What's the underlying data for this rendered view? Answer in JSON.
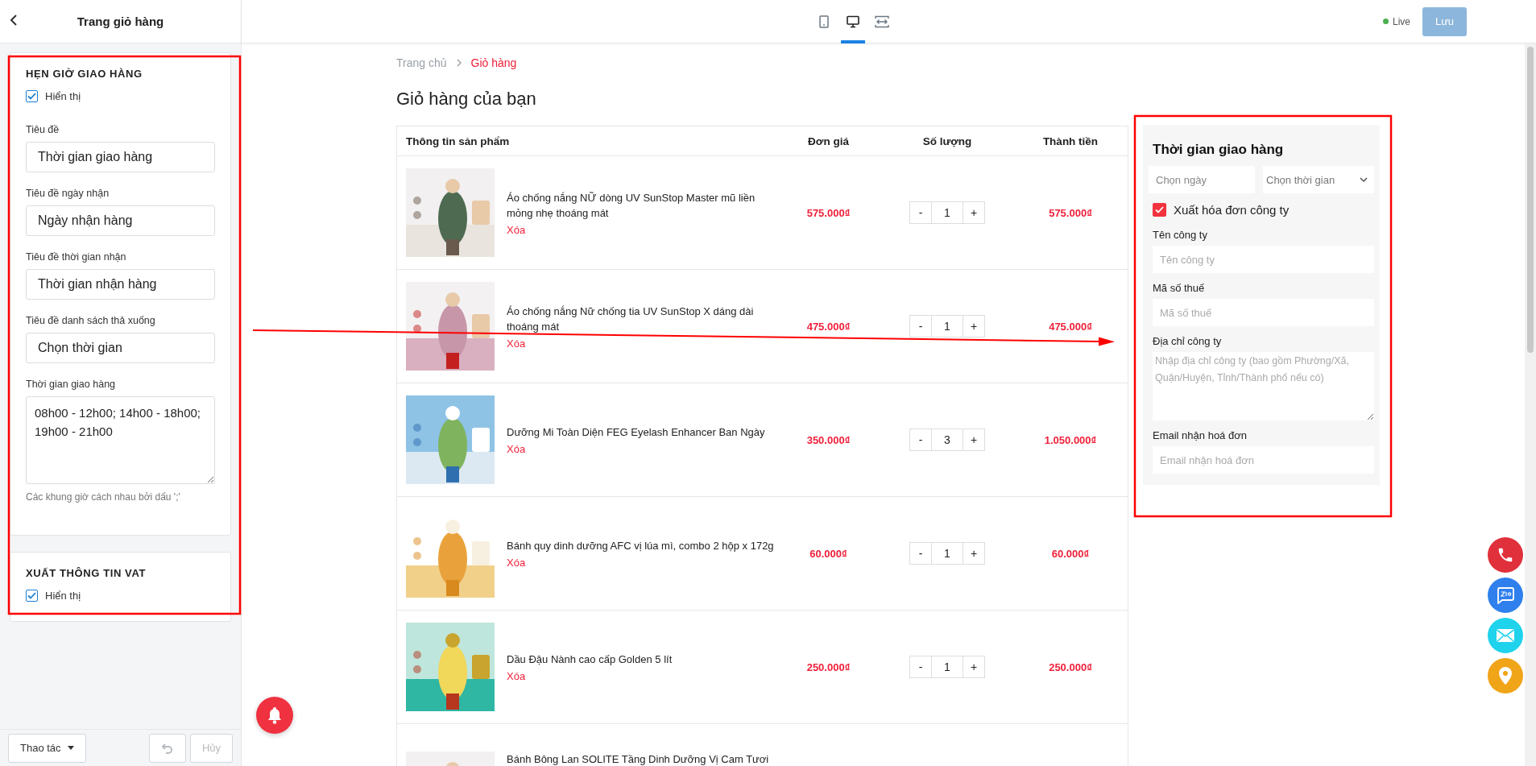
{
  "sidebar": {
    "title": "Trang giỏ hàng",
    "sections": [
      {
        "heading": "HẸN GIỜ GIAO HÀNG",
        "show": {
          "label": "Hiển thị",
          "checked": true
        },
        "fields": [
          {
            "kind": "input",
            "label": "Tiêu đề",
            "value": "Thời gian giao hàng"
          },
          {
            "kind": "input",
            "label": "Tiêu đề ngày nhận",
            "value": "Ngày nhận hàng"
          },
          {
            "kind": "input",
            "label": "Tiêu đề thời gian nhận",
            "value": "Thời gian nhận hàng"
          },
          {
            "kind": "input",
            "label": "Tiêu đề danh sách thả xuống",
            "value": "Chọn thời gian"
          },
          {
            "kind": "textarea",
            "label": "Thời gian giao hàng",
            "value": "08h00 - 12h00; 14h00 - 18h00; 19h00 - 21h00"
          }
        ],
        "hint": "Các khung giờ cách nhau bởi dấu ';'"
      },
      {
        "heading": "XUẤT THÔNG TIN VAT",
        "show": {
          "label": "Hiển thị",
          "checked": true
        }
      }
    ],
    "footer": {
      "actions_button": "Thao tác",
      "undo": {
        "disabled": true
      },
      "cancel": {
        "label": "Hủy",
        "disabled": true
      }
    }
  },
  "topbar": {
    "device_tabs": [
      {
        "kind": "tablet",
        "selected": false
      },
      {
        "kind": "desktop",
        "selected": true
      },
      {
        "kind": "fit-width",
        "selected": false
      }
    ],
    "status": "Live",
    "save": {
      "label": "Lưu",
      "disabled": true
    }
  },
  "breadcrumb": [
    {
      "label": "Trang chủ",
      "selected": false
    },
    {
      "label": "Giỏ hàng",
      "selected": true
    }
  ],
  "page_title": "Giỏ hàng của bạn",
  "table": {
    "columns": [
      "Thông tin sản phẩm",
      "Đơn giá",
      "Số lượng",
      "Thành tiền"
    ],
    "rows": [
      {
        "name": "Áo chống nắng NỮ dòng UV SunStop Master mũ liền mỏng nhẹ thoáng mát",
        "action": "Xóa",
        "price": "575.000₫",
        "quantity": "1",
        "total": "575.000₫"
      },
      {
        "name": "Áo chống nắng Nữ chống tia UV SunStop X dáng dài thoáng mát",
        "action": "Xóa",
        "price": "475.000₫",
        "quantity": "1",
        "total": "475.000₫"
      },
      {
        "name": "Dưỡng Mi Toàn Diện FEG Eyelash Enhancer Ban Ngày",
        "action": "Xóa",
        "price": "350.000₫",
        "quantity": "3",
        "total": "1.050.000₫"
      },
      {
        "name": "Bánh quy dinh dưỡng AFC vị lúa mì, combo 2 hộp x 172g",
        "action": "Xóa",
        "price": "60.000₫",
        "quantity": "1",
        "total": "60.000₫"
      },
      {
        "name": "Dầu Đậu Nành cao cấp Golden 5 lít",
        "action": "Xóa",
        "price": "250.000₫",
        "quantity": "1",
        "total": "250.000₫"
      },
      {
        "name": "Bánh Bông Lan SOLITE Tầng Dinh Dưỡng Vị Cam Tươi"
      }
    ],
    "minus": "-",
    "plus": "+"
  },
  "delivery": {
    "title": "Thời gian giao hàng",
    "date_placeholder": "Chọn ngày",
    "time_placeholder": "Chọn thời gian",
    "invoice": {
      "label": "Xuất hóa đơn công ty",
      "checked": true
    },
    "fields": [
      {
        "kind": "input",
        "label": "Tên công ty",
        "placeholder": "Tên công ty"
      },
      {
        "kind": "input",
        "label": "Mã số thuế",
        "placeholder": "Mã số thuế"
      },
      {
        "kind": "textarea",
        "label": "Địa chỉ công ty",
        "placeholder": "Nhập địa chỉ công ty (bao gồm Phường/Xã, Quận/Huyện, Tỉnh/Thành phố nếu có)"
      },
      {
        "kind": "input",
        "label": "Email nhận hoá đơn",
        "placeholder": "Email nhận hoá đơn"
      }
    ]
  }
}
